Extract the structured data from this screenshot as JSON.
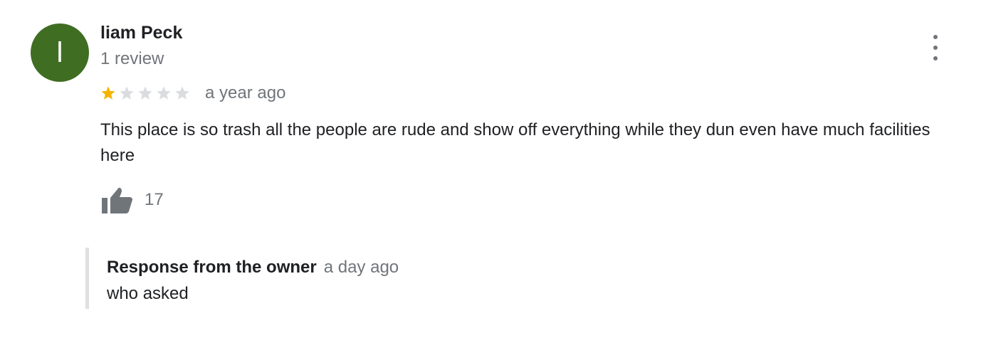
{
  "review": {
    "author": {
      "avatar_initial": "l",
      "avatar_color": "#3f6d22",
      "name": "liam Peck",
      "review_count": "1 review"
    },
    "rating": {
      "value": 1,
      "max": 5,
      "filled_color": "#f5b400",
      "empty_color": "#dadce0"
    },
    "time_ago": "a year ago",
    "text": "This place is so trash all the people are rude and show off everything while they dun even have much facilities here",
    "likes": {
      "icon": "thumbs-up-icon",
      "count": "17"
    },
    "menu_icon": "more-vert-icon",
    "owner_response": {
      "label": "Response from the owner",
      "time_ago": "a day ago",
      "text": "who asked"
    }
  }
}
